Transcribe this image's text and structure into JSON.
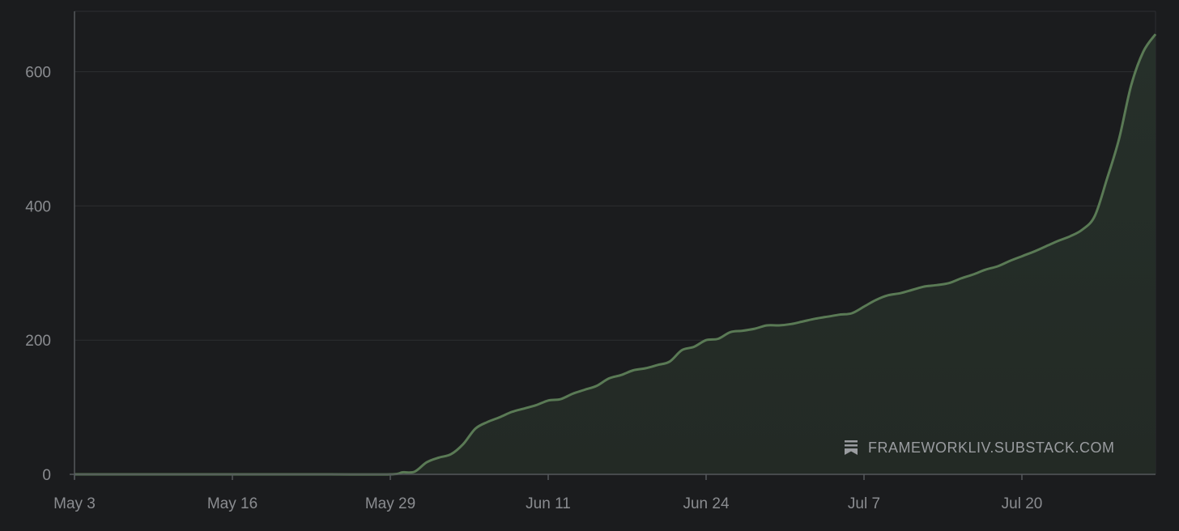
{
  "colors": {
    "background": "#1b1c1e",
    "line": "#5a7a55",
    "area": "#26302a",
    "grid": "#2c2e31",
    "tick_text": "#8a8c90"
  },
  "watermark": {
    "icon": "substack-bookmark-icon",
    "text": "FRAMEWORKLIV.SUBSTACK.COM"
  },
  "chart_data": {
    "type": "area",
    "title": "",
    "xlabel": "",
    "ylabel": "",
    "grid": true,
    "legend": "none",
    "x_ticks": [
      "May 3",
      "May 16",
      "May 29",
      "Jun 11",
      "Jun 24",
      "Jul 7",
      "Jul 20"
    ],
    "y_ticks": [
      0,
      200,
      400,
      600
    ],
    "xlim": [
      "May 3",
      "Jul 31"
    ],
    "ylim": [
      0,
      690
    ],
    "series": [
      {
        "x": [
          "May 3",
          "May 10",
          "May 17",
          "May 24",
          "May 29",
          "May 30",
          "May 31",
          "Jun 1",
          "Jun 2",
          "Jun 3",
          "Jun 4",
          "Jun 5",
          "Jun 6",
          "Jun 7",
          "Jun 8",
          "Jun 9",
          "Jun 10",
          "Jun 11",
          "Jun 12",
          "Jun 13",
          "Jun 14",
          "Jun 15",
          "Jun 16",
          "Jun 17",
          "Jun 18",
          "Jun 19",
          "Jun 20",
          "Jun 21",
          "Jun 22",
          "Jun 23",
          "Jun 24",
          "Jun 25",
          "Jun 26",
          "Jun 27",
          "Jun 28",
          "Jun 29",
          "Jun 30",
          "Jul 1",
          "Jul 2",
          "Jul 3",
          "Jul 4",
          "Jul 5",
          "Jul 6",
          "Jul 7",
          "Jul 8",
          "Jul 9",
          "Jul 10",
          "Jul 11",
          "Jul 12",
          "Jul 13",
          "Jul 14",
          "Jul 15",
          "Jul 16",
          "Jul 17",
          "Jul 18",
          "Jul 19",
          "Jul 20",
          "Jul 21",
          "Jul 22",
          "Jul 23",
          "Jul 24",
          "Jul 25",
          "Jul 26",
          "Jul 27",
          "Jul 28",
          "Jul 29",
          "Jul 30",
          "Jul 31"
        ],
        "y": [
          0,
          0,
          0,
          0,
          0,
          3,
          4,
          18,
          25,
          30,
          45,
          68,
          78,
          85,
          93,
          98,
          103,
          110,
          112,
          120,
          126,
          132,
          143,
          148,
          155,
          158,
          163,
          168,
          185,
          190,
          200,
          202,
          212,
          214,
          217,
          222,
          222,
          224,
          228,
          232,
          235,
          238,
          240,
          250,
          260,
          267,
          270,
          275,
          280,
          282,
          285,
          292,
          298,
          305,
          310,
          318,
          325,
          332,
          340,
          348,
          355,
          365,
          385,
          440,
          500,
          580,
          630,
          656
        ]
      }
    ]
  }
}
